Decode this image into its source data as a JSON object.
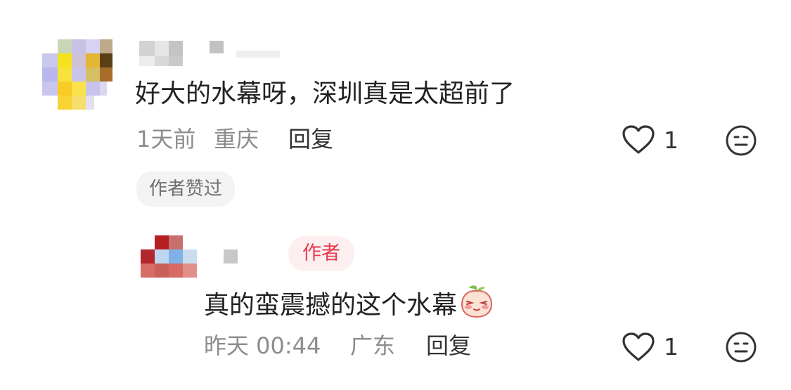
{
  "comment": {
    "text": "好大的水幕呀，深圳真是太超前了",
    "time": "1天前",
    "location": "重庆",
    "reply_label": "回复",
    "like_count": "1",
    "author_liked_badge": "作者赞过"
  },
  "reply": {
    "author_tag": "作者",
    "text": "真的蛮震撼的这个水幕",
    "time": "昨天 00:44",
    "location": "广东",
    "reply_label": "回复",
    "like_count": "1"
  },
  "icons": {
    "like": "heart-outline-icon",
    "more": "neutral-face-icon",
    "emoji": "blushing-peach-emoji"
  },
  "colors": {
    "author_tag_text": "#e8394d",
    "author_tag_bg": "#fdeff0",
    "meta_text": "#8c8c8c"
  }
}
